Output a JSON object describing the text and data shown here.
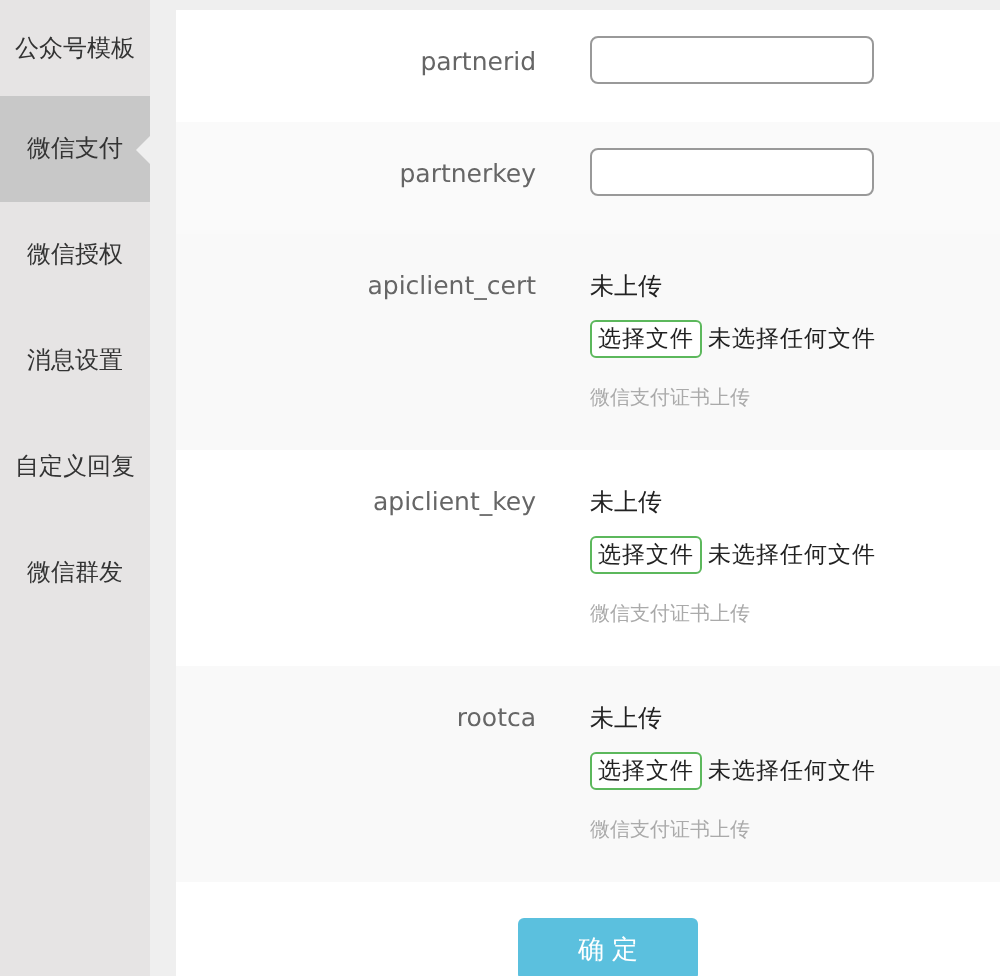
{
  "sidebar": {
    "items": [
      {
        "label": "公众号模板",
        "selected": false
      },
      {
        "label": "微信支付",
        "selected": true
      },
      {
        "label": "微信授权",
        "selected": false
      },
      {
        "label": "消息设置",
        "selected": false
      },
      {
        "label": "自定义回复",
        "selected": false
      },
      {
        "label": "微信群发",
        "selected": false
      }
    ]
  },
  "form": {
    "rows": [
      {
        "kind": "text",
        "label": "partnerid"
      },
      {
        "kind": "text",
        "label": "partnerkey"
      },
      {
        "kind": "file",
        "label": "apiclient_cert",
        "status": "未上传",
        "button": "选择文件",
        "file_status": "未选择任何文件",
        "hint": "微信支付证书上传"
      },
      {
        "kind": "file",
        "label": "apiclient_key",
        "status": "未上传",
        "button": "选择文件",
        "file_status": "未选择任何文件",
        "hint": "微信支付证书上传"
      },
      {
        "kind": "file",
        "label": "rootca",
        "status": "未上传",
        "button": "选择文件",
        "file_status": "未选择任何文件",
        "hint": "微信支付证书上传"
      }
    ],
    "submit": "确 定"
  }
}
